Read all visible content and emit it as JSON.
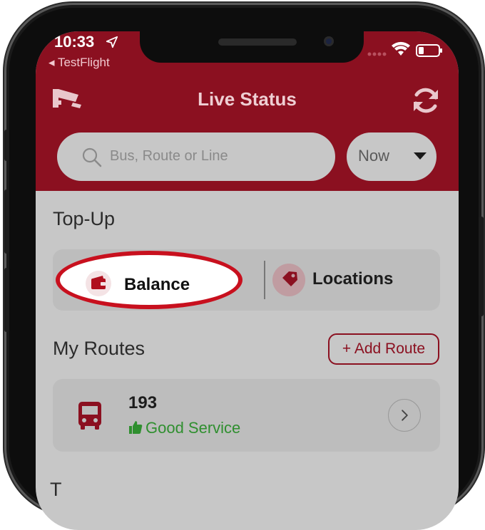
{
  "status_bar": {
    "time": "10:33",
    "back_app": "◂ TestFlight"
  },
  "header": {
    "title": "Live Status"
  },
  "search": {
    "placeholder": "Bus, Route or Line"
  },
  "time_filter": {
    "selected": "Now"
  },
  "topup": {
    "title": "Top-Up",
    "balance_label": "Balance",
    "locations_label": "Locations"
  },
  "my_routes": {
    "title": "My Routes",
    "add_label": "+ Add Route",
    "routes": [
      {
        "number": "193",
        "status": "Good Service"
      }
    ]
  },
  "next_section": {
    "title_partial": "T"
  },
  "colors": {
    "brand": "#8b1020",
    "highlight": "#c8101e",
    "good_service": "#2f8f2f"
  },
  "icons": [
    "camera-icon",
    "refresh-icon",
    "search-icon",
    "wallet-icon",
    "location-tag-icon",
    "bus-icon",
    "thumbs-up-icon",
    "chevron-right-icon"
  ]
}
